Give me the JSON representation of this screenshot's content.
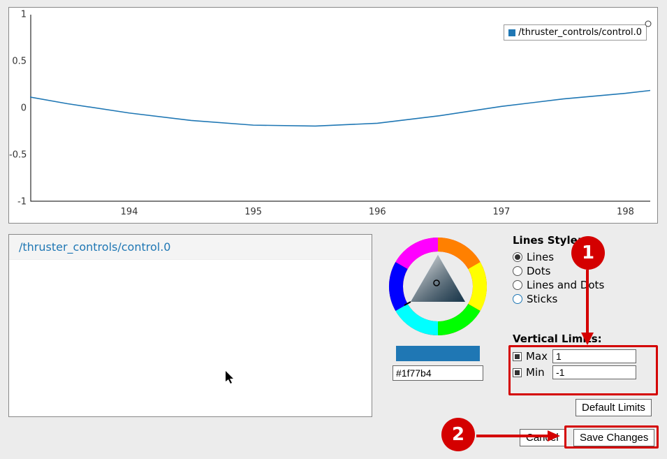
{
  "legend_label": "/thruster_controls/control.0",
  "y_ticks": [
    "1",
    "0.5",
    "0",
    "-0.5",
    "-1"
  ],
  "x_ticks": [
    "194",
    "195",
    "196",
    "197",
    "198"
  ],
  "list_items": [
    "/thruster_controls/control.0"
  ],
  "color_hex": "#1f77b4",
  "lines_style_title": "Lines Style:",
  "style_options": {
    "lines": "Lines",
    "dots": "Dots",
    "lines_and_dots": "Lines and Dots",
    "sticks": "Sticks"
  },
  "vertical_limits_title": "Vertical Limits:",
  "max_label": "Max",
  "min_label": "Min",
  "max_value": "1",
  "min_value": "-1",
  "default_limits_label": "Default Limits",
  "cancel_label": "Cancel",
  "save_label": "Save Changes",
  "anno1": "1",
  "anno2": "2",
  "chart_data": {
    "type": "line",
    "series": [
      {
        "name": "/thruster_controls/control.0",
        "x": [
          193.2,
          193.5,
          194.0,
          194.5,
          195.0,
          195.5,
          196.0,
          196.5,
          197.0,
          197.5,
          198.0,
          198.2
        ],
        "y": [
          0.12,
          0.05,
          -0.05,
          -0.13,
          -0.18,
          -0.19,
          -0.16,
          -0.08,
          0.02,
          0.1,
          0.16,
          0.19
        ]
      }
    ],
    "xlim": [
      193.2,
      198.2
    ],
    "ylim": [
      -1,
      1
    ],
    "xlabel": "",
    "ylabel": ""
  }
}
